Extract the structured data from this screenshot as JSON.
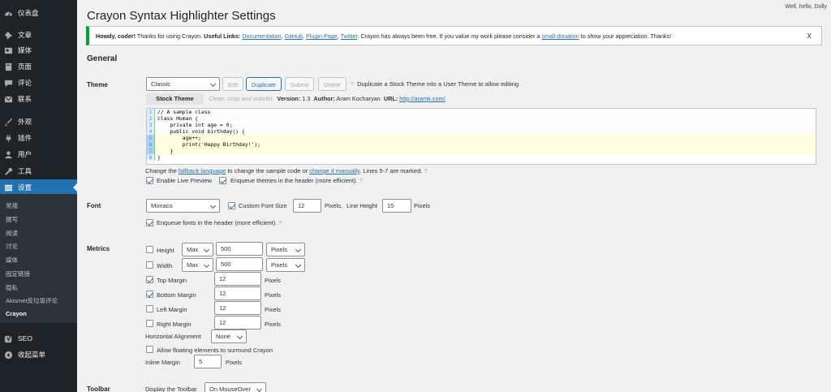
{
  "sidebar": {
    "items": [
      {
        "label": "仪表盘",
        "icon": "dashboard-icon"
      },
      {
        "label": "文章",
        "icon": "pin-icon"
      },
      {
        "label": "媒体",
        "icon": "media-icon"
      },
      {
        "label": "页面",
        "icon": "page-icon"
      },
      {
        "label": "评论",
        "icon": "comment-icon"
      },
      {
        "label": "联系",
        "icon": "mail-icon"
      },
      {
        "label": "外观",
        "icon": "brush-icon"
      },
      {
        "label": "插件",
        "icon": "plugin-icon"
      },
      {
        "label": "用户",
        "icon": "user-icon"
      },
      {
        "label": "工具",
        "icon": "wrench-icon"
      },
      {
        "label": "设置",
        "icon": "settings-icon"
      },
      {
        "label": "SEO",
        "icon": "yoast-icon"
      },
      {
        "label": "收起菜单",
        "icon": "collapse-icon"
      }
    ],
    "submenu": [
      "常规",
      "撰写",
      "阅读",
      "讨论",
      "媒体",
      "固定链接",
      "隐私",
      "Akismet反垃圾评论",
      "Crayon"
    ],
    "active_color": "#2271b1"
  },
  "header": {
    "howdy": "Well, hello, Dolly",
    "title": "Crayon Syntax Highlighter Settings"
  },
  "notice": {
    "bold1": "Howdy, coder!",
    "text1": " Thanks for using Crayon. ",
    "bold2": "Useful Links:",
    "link_docs": "Documentation",
    "link_github": "GitHub",
    "link_plugin": "Plugin Page",
    "link_twitter": "Twitter",
    "text2": ". Crayon has always been free. If you value my work please consider a ",
    "link_donation": "small donation",
    "text3": " to show your appreciation. Thanks!",
    "close": "X"
  },
  "general": {
    "heading": "General"
  },
  "theme": {
    "label": "Theme",
    "select": "Classic",
    "btn_edit": "Edit",
    "btn_duplicate": "Duplicate",
    "btn_submit": "Submit",
    "btn_delete": "Delete",
    "help": "?",
    "hint": "Duplicate a Stock Theme into a User Theme to allow editing.",
    "stock_tab": "Stock Theme",
    "description": "Clean, crisp and colorful.",
    "version_label": "Version:",
    "version": "1.3",
    "author_label": "Author:",
    "author": "Aram Kocharyan",
    "url_label": "URL:",
    "url": "http://aramk.com/",
    "code_lines": [
      {
        "n": "1",
        "t": "// A sample class"
      },
      {
        "n": "2",
        "t": "class Human {"
      },
      {
        "n": "3",
        "t": "    private int age = 0;"
      },
      {
        "n": "4",
        "t": "    public void birthday() {"
      },
      {
        "n": "5",
        "t": "        age++;"
      },
      {
        "n": "6",
        "t": "        print('Happy Birthday!');"
      },
      {
        "n": "7",
        "t": "    }"
      },
      {
        "n": "8",
        "t": "}"
      }
    ],
    "change_text1": "Change the ",
    "fallback_link": "fallback language",
    "change_text2": " to change the sample code or ",
    "change_manual_link": "change it manually",
    "change_text3": ". Lines 5-7 are marked.",
    "live_preview": "Enable Live Preview",
    "enqueue_themes": "Enqueue themes in the header (more efficient)."
  },
  "font": {
    "label": "Font",
    "select": "Monaco",
    "custom_size": "Custom Font Size",
    "size_value": "12",
    "pixels1": "Pixels,",
    "line_height": "Line Height",
    "line_height_value": "15",
    "pixels2": "Pixels",
    "enqueue_fonts": "Enqueue fonts in the header (more efficient)."
  },
  "metrics": {
    "label": "Metrics",
    "height": "Height",
    "height_mode": "Max",
    "height_value": "500",
    "height_unit": "Pixels",
    "width": "Width",
    "width_mode": "Max",
    "width_value": "500",
    "width_unit": "Pixels",
    "top_margin": "Top Margin",
    "top_value": "12",
    "bottom_margin": "Bottom Margin",
    "bottom_value": "12",
    "left_margin": "Left Margin",
    "left_value": "12",
    "right_margin": "Right Margin",
    "right_value": "12",
    "pixels": "Pixels",
    "h_align": "Horizontal Alignment",
    "h_align_value": "None",
    "floating": "Allow floating elements to surround Crayon",
    "inline_margin": "Inline Margin",
    "inline_value": "5"
  },
  "toolbar": {
    "label": "Toolbar",
    "display": "Display the Toolbar",
    "display_value": "On MouseOver"
  }
}
